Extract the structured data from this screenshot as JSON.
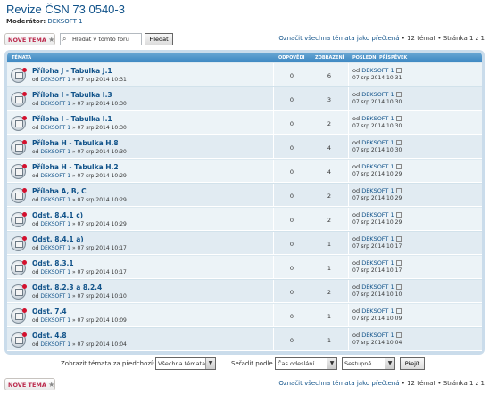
{
  "header": {
    "title": "Revize ČSN 73 0540-3",
    "moderator_label": "Moderátor:",
    "moderator_name": "DEKSOFT 1"
  },
  "toolbar": {
    "new_topic_label": "NOVÉ TÉMA",
    "new_topic_icon": "star-icon",
    "search_placeholder": "Hledat v tomto fóru",
    "search_button": "Hledat",
    "mark_read": "Označit všechna témata jako přečtená",
    "topic_count": "12 témat",
    "page_label": "Stránka 1 z 1"
  },
  "columns": {
    "topics": "Témata",
    "replies": "Odpovědi",
    "views": "Zobrazení",
    "last_post": "Poslední příspěvek"
  },
  "topics": [
    {
      "title": "Příloha J - Tabulka J.1",
      "by": "od",
      "author": "DEKSOFT 1",
      "date": "» 07 srp 2014 10:31",
      "replies": "0",
      "views": "6",
      "last_by": "od",
      "last_author": "DEKSOFT 1",
      "last_date": "07 srp 2014 10:31"
    },
    {
      "title": "Příloha I - Tabulka I.3",
      "by": "od",
      "author": "DEKSOFT 1",
      "date": "» 07 srp 2014 10:30",
      "replies": "0",
      "views": "3",
      "last_by": "od",
      "last_author": "DEKSOFT 1",
      "last_date": "07 srp 2014 10:30"
    },
    {
      "title": "Příloha I - Tabulka I.1",
      "by": "od",
      "author": "DEKSOFT 1",
      "date": "» 07 srp 2014 10:30",
      "replies": "0",
      "views": "2",
      "last_by": "od",
      "last_author": "DEKSOFT 1",
      "last_date": "07 srp 2014 10:30"
    },
    {
      "title": "Příloha H - Tabulka H.8",
      "by": "od",
      "author": "DEKSOFT 1",
      "date": "» 07 srp 2014 10:30",
      "replies": "0",
      "views": "4",
      "last_by": "od",
      "last_author": "DEKSOFT 1",
      "last_date": "07 srp 2014 10:30"
    },
    {
      "title": "Příloha H - Tabulka H.2",
      "by": "od",
      "author": "DEKSOFT 1",
      "date": "» 07 srp 2014 10:29",
      "replies": "0",
      "views": "4",
      "last_by": "od",
      "last_author": "DEKSOFT 1",
      "last_date": "07 srp 2014 10:29"
    },
    {
      "title": "Přílohа A, B, C",
      "by": "od",
      "author": "DEKSOFT 1",
      "date": "» 07 srp 2014 10:29",
      "replies": "0",
      "views": "2",
      "last_by": "od",
      "last_author": "DEKSOFT 1",
      "last_date": "07 srp 2014 10:29"
    },
    {
      "title": "Odst. 8.4.1 c)",
      "by": "od",
      "author": "DEKSOFT 1",
      "date": "» 07 srp 2014 10:29",
      "replies": "0",
      "views": "2",
      "last_by": "od",
      "last_author": "DEKSOFT 1",
      "last_date": "07 srp 2014 10:29"
    },
    {
      "title": "Odst. 8.4.1 a)",
      "by": "od",
      "author": "DEKSOFT 1",
      "date": "» 07 srp 2014 10:17",
      "replies": "0",
      "views": "1",
      "last_by": "od",
      "last_author": "DEKSOFT 1",
      "last_date": "07 srp 2014 10:17"
    },
    {
      "title": "Odst. 8.3.1",
      "by": "od",
      "author": "DEKSOFT 1",
      "date": "» 07 srp 2014 10:17",
      "replies": "0",
      "views": "1",
      "last_by": "od",
      "last_author": "DEKSOFT 1",
      "last_date": "07 srp 2014 10:17"
    },
    {
      "title": "Odst. 8.2.3 a 8.2.4",
      "by": "od",
      "author": "DEKSOFT 1",
      "date": "» 07 srp 2014 10:10",
      "replies": "0",
      "views": "2",
      "last_by": "od",
      "last_author": "DEKSOFT 1",
      "last_date": "07 srp 2014 10:10"
    },
    {
      "title": "Odst. 7.4",
      "by": "od",
      "author": "DEKSOFT 1",
      "date": "» 07 srp 2014 10:09",
      "replies": "0",
      "views": "1",
      "last_by": "od",
      "last_author": "DEKSOFT 1",
      "last_date": "07 srp 2014 10:09"
    },
    {
      "title": "Odst. 4.8",
      "by": "od",
      "author": "DEKSOFT 1",
      "date": "» 07 srp 2014 10:04",
      "replies": "0",
      "views": "1",
      "last_by": "od",
      "last_author": "DEKSOFT 1",
      "last_date": "07 srp 2014 10:04"
    }
  ],
  "filter": {
    "show_label": "Zobrazit témata za předchozí:",
    "show_value": "Všechna témata",
    "sort_label": "Seřadit podle",
    "sort_value": "Čas odeslání",
    "order_value": "Sestupně",
    "go_button": "Přejít"
  }
}
